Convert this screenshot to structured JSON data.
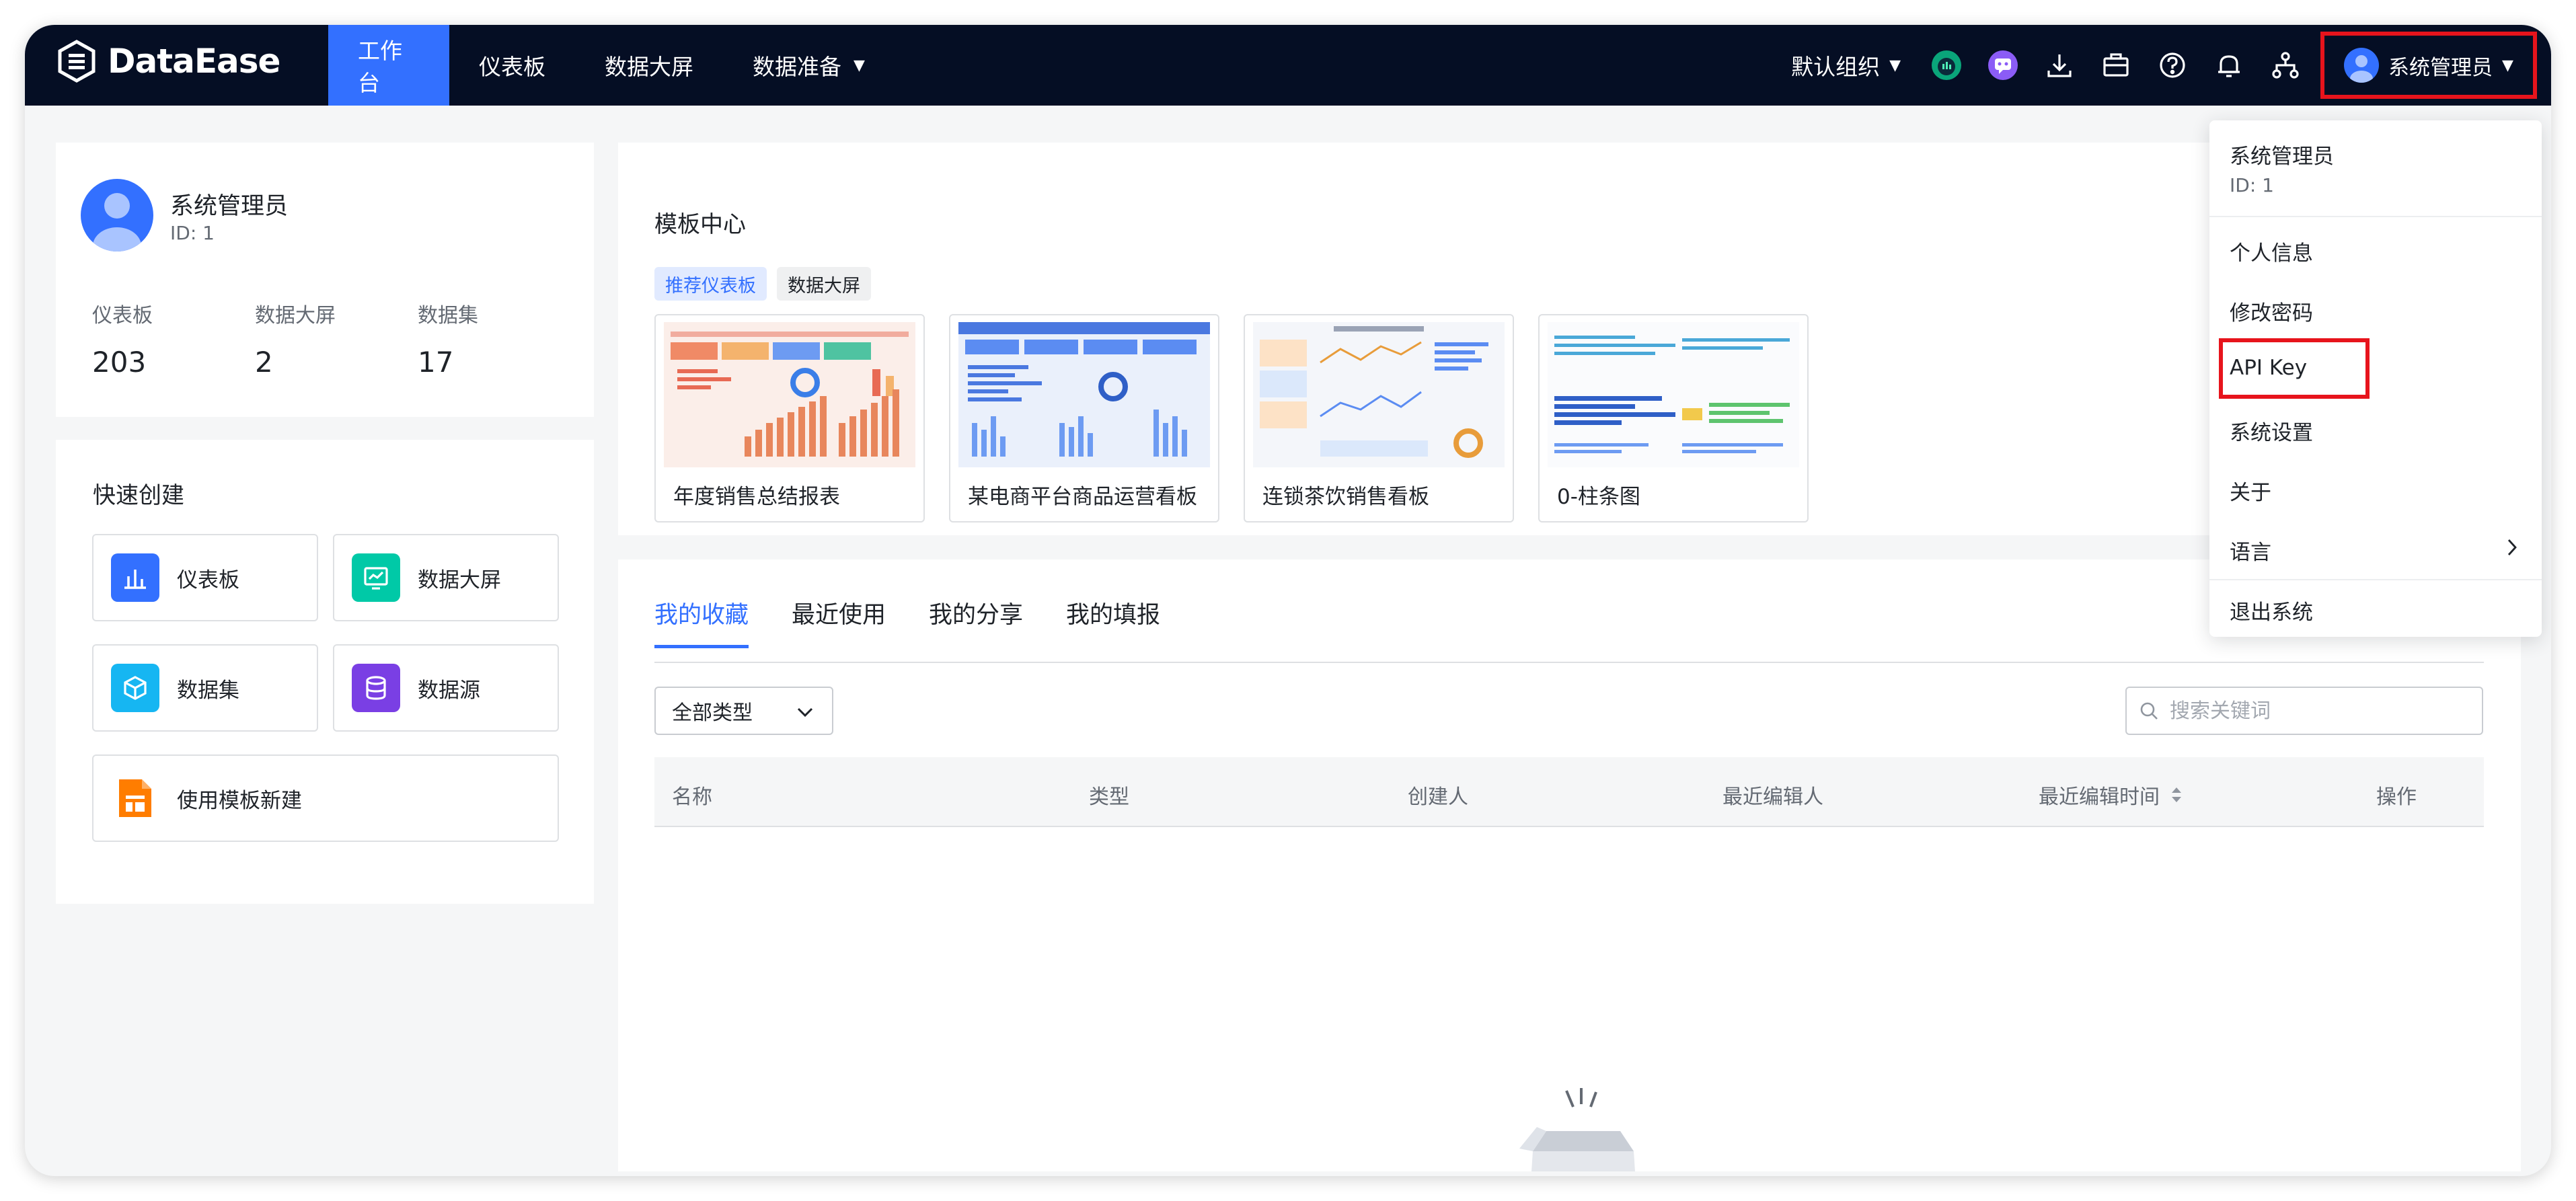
{
  "app": {
    "brand": "DataEase",
    "nav": [
      {
        "label": "工作台",
        "active": true
      },
      {
        "label": "仪表板",
        "active": false
      },
      {
        "label": "数据大屏",
        "active": false
      },
      {
        "label": "数据准备",
        "active": false,
        "has_dropdown": true
      }
    ],
    "org_label": "默认组织",
    "user_name": "系统管理员",
    "accent": "#3370ff",
    "highlight": "#e7141c"
  },
  "profile": {
    "name": "系统管理员",
    "id_text": "ID: 1",
    "stats": [
      {
        "label": "仪表板",
        "value": "203"
      },
      {
        "label": "数据大屏",
        "value": "2"
      },
      {
        "label": "数据集",
        "value": "17"
      }
    ]
  },
  "quick_create": {
    "title": "快速创建",
    "items": [
      {
        "label": "仪表板",
        "icon": "bar-chart-icon",
        "color": "#3370ff"
      },
      {
        "label": "数据大屏",
        "icon": "screen-icon",
        "color": "#00c9a7"
      },
      {
        "label": "数据集",
        "icon": "cube-icon",
        "color": "#16b6f2"
      },
      {
        "label": "数据源",
        "icon": "database-icon",
        "color": "#7a3fe4"
      },
      {
        "label": "使用模板新建",
        "icon": "template-icon",
        "color": "#ff7d00"
      }
    ]
  },
  "template_center": {
    "title": "模板中心",
    "tabs": [
      {
        "label": "推荐仪表板",
        "active": true
      },
      {
        "label": "数据大屏",
        "active": false
      }
    ],
    "templates": [
      {
        "name": "年度销售总结报表"
      },
      {
        "name": "某电商平台商品运营看板"
      },
      {
        "name": "连锁茶饮销售看板"
      },
      {
        "name": "0-柱条图"
      }
    ]
  },
  "resources": {
    "tabs": [
      {
        "label": "我的收藏",
        "active": true
      },
      {
        "label": "最近使用",
        "active": false
      },
      {
        "label": "我的分享",
        "active": false
      },
      {
        "label": "我的填报",
        "active": false
      }
    ],
    "type_filter": "全部类型",
    "search_placeholder": "搜索关键词",
    "columns": [
      "名称",
      "类型",
      "创建人",
      "最近编辑人",
      "最近编辑时间",
      "操作"
    ]
  },
  "user_menu": {
    "name": "系统管理员",
    "id_text": "ID: 1",
    "items": [
      "个人信息",
      "修改密码",
      "API Key",
      "系统设置",
      "关于",
      "语言"
    ],
    "logout": "退出系统"
  }
}
